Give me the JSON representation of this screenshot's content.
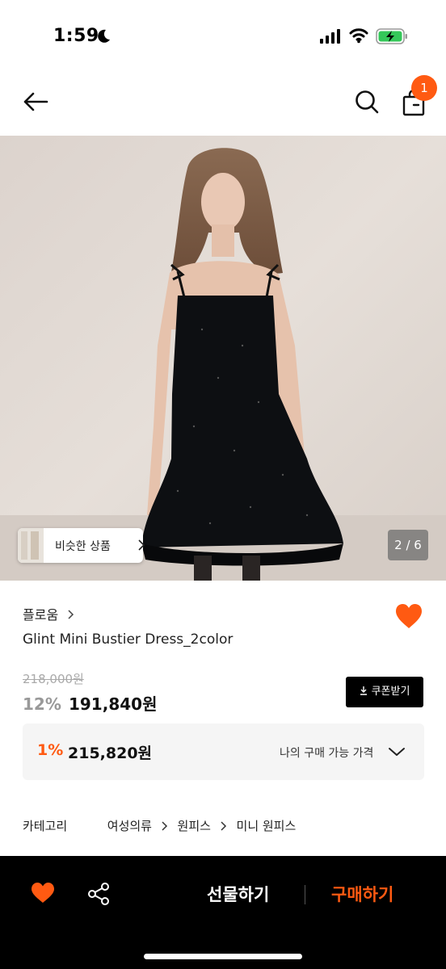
{
  "status_bar": {
    "time": "1:59",
    "icons": [
      "moon-icon",
      "signal-icon",
      "wifi-icon",
      "battery-charging-icon"
    ]
  },
  "nav": {
    "icons": [
      "back-arrow-icon",
      "search-icon",
      "shopping-bag-icon"
    ],
    "cart_count": "1"
  },
  "gallery": {
    "similar_label": "비슷한 상품",
    "page_indicator": "2 / 6"
  },
  "product": {
    "brand": "플로움",
    "name": "Glint Mini Bustier Dress_2color",
    "original_price": "218,000원",
    "discount_pct": "12%",
    "sale_price": "191,840원",
    "coupon_label": "쿠폰받기"
  },
  "my_price": {
    "discount_pct": "1%",
    "price": "215,820원",
    "label": "나의 구매 가능 가격"
  },
  "category": {
    "label": "카테고리",
    "path": [
      "여성의류",
      "원피스",
      "미니 원피스"
    ]
  },
  "bottom_bar": {
    "gift_label": "선물하기",
    "buy_label": "구매하기"
  },
  "colors": {
    "accent": "#ff5a12",
    "black": "#000000",
    "panel": "#f5f5f5"
  }
}
